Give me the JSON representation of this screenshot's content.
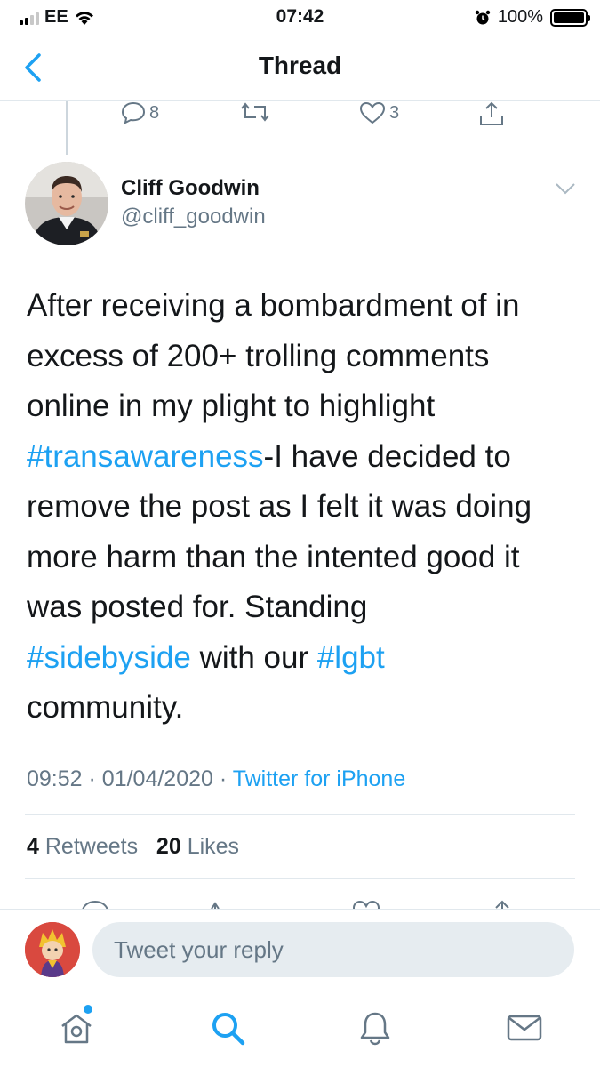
{
  "status_bar": {
    "carrier": "EE",
    "time": "07:42",
    "battery_percent": "100%",
    "battery_level": 1.0,
    "icons": [
      "signal-icon",
      "wifi-icon",
      "alarm-icon",
      "battery-icon"
    ]
  },
  "nav": {
    "title": "Thread",
    "back_icon": "chevron-left-icon"
  },
  "previous_tweet_actions": {
    "reply_count": "8",
    "like_count": "3"
  },
  "tweet": {
    "author_name": "Cliff Goodwin",
    "author_handle": "@cliff_goodwin",
    "text_lines": [
      [
        {
          "t": "After receiving a bombardment of in",
          "tag": false
        }
      ],
      [
        {
          "t": "excess of 200+ trolling comments",
          "tag": false
        }
      ],
      [
        {
          "t": "online in my plight to highlight",
          "tag": false
        }
      ],
      [
        {
          "t": "#transawareness",
          "tag": true
        },
        {
          "t": "-I have decided to",
          "tag": false
        }
      ],
      [
        {
          "t": "remove the post as I felt it was doing",
          "tag": false
        }
      ],
      [
        {
          "t": "more harm than the intented good it",
          "tag": false
        }
      ],
      [
        {
          "t": "was posted for. Standing",
          "tag": false
        }
      ],
      [
        {
          "t": "#sidebyside",
          "tag": true
        },
        {
          "t": " with our ",
          "tag": false
        },
        {
          "t": "#lgbt",
          "tag": true
        }
      ],
      [
        {
          "t": "community.",
          "tag": false
        }
      ]
    ],
    "time": "09:52",
    "date": "01/04/2020",
    "source": "Twitter for iPhone",
    "retweets_count": "4",
    "retweets_label": "Retweets",
    "likes_count": "20",
    "likes_label": "Likes"
  },
  "reply": {
    "placeholder": "Tweet your reply"
  },
  "colors": {
    "accent": "#1da1f2",
    "muted": "#657786",
    "text": "#14171a",
    "border": "#e1e8ed"
  },
  "tab_bar": {
    "items": [
      "home-icon",
      "search-icon",
      "notifications-icon",
      "messages-icon"
    ],
    "active": "search-icon"
  }
}
